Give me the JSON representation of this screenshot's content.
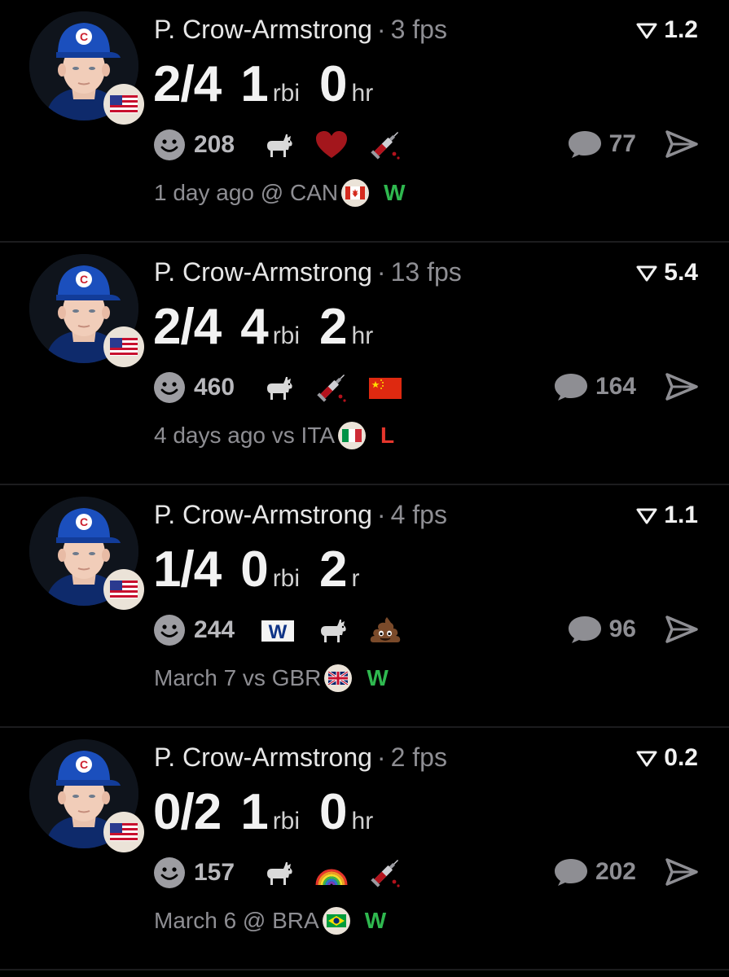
{
  "colors": {
    "win": "#2fb84f",
    "loss": "#e5362c",
    "muted": "#8e8e93"
  },
  "posts": [
    {
      "player": "P. Crow-Armstrong",
      "fps": "3 fps",
      "score": "1.2",
      "stats": [
        {
          "value": "2/4",
          "unit": ""
        },
        {
          "value": "1",
          "unit": "rbi"
        },
        {
          "value": "0",
          "unit": "hr"
        }
      ],
      "reaction_count": "208",
      "reactions": [
        "goat-icon",
        "heart-icon",
        "syringe-icon"
      ],
      "comment_count": "77",
      "when": "1 day ago @ CAN",
      "opponent_flag": "canada-flag-icon",
      "result": "W"
    },
    {
      "player": "P. Crow-Armstrong",
      "fps": "13 fps",
      "score": "5.4",
      "stats": [
        {
          "value": "2/4",
          "unit": ""
        },
        {
          "value": "4",
          "unit": "rbi"
        },
        {
          "value": "2",
          "unit": "hr"
        }
      ],
      "reaction_count": "460",
      "reactions": [
        "goat-icon",
        "syringe-icon",
        "china-flag-icon"
      ],
      "comment_count": "164",
      "when": "4 days ago vs ITA",
      "opponent_flag": "italy-flag-icon",
      "result": "L"
    },
    {
      "player": "P. Crow-Armstrong",
      "fps": "4 fps",
      "score": "1.1",
      "stats": [
        {
          "value": "1/4",
          "unit": ""
        },
        {
          "value": "0",
          "unit": "rbi"
        },
        {
          "value": "2",
          "unit": "r"
        }
      ],
      "reaction_count": "244",
      "reactions": [
        "w-flag-icon",
        "goat-icon",
        "poop-icon"
      ],
      "comment_count": "96",
      "when": "March 7 vs GBR",
      "opponent_flag": "uk-flag-icon",
      "result": "W"
    },
    {
      "player": "P. Crow-Armstrong",
      "fps": "2 fps",
      "score": "0.2",
      "stats": [
        {
          "value": "0/2",
          "unit": ""
        },
        {
          "value": "1",
          "unit": "rbi"
        },
        {
          "value": "0",
          "unit": "hr"
        }
      ],
      "reaction_count": "157",
      "reactions": [
        "goat-icon",
        "rainbow-icon",
        "syringe-icon"
      ],
      "comment_count": "202",
      "when": "March 6 @ BRA",
      "opponent_flag": "brazil-flag-icon",
      "result": "W"
    }
  ]
}
